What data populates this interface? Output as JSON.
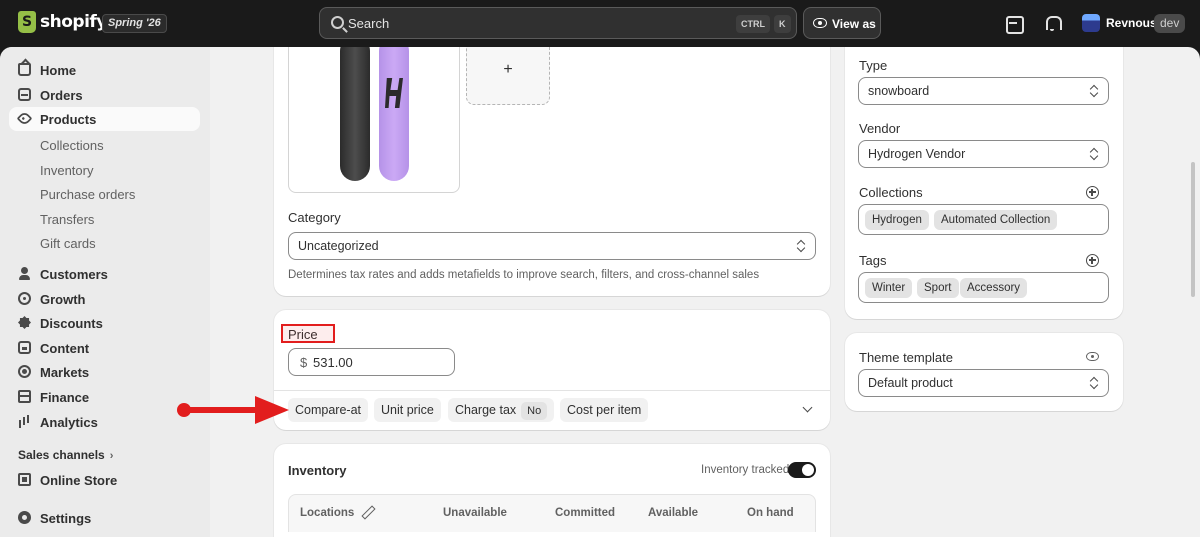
{
  "topbar": {
    "logo_text": "shopify",
    "edition": "Spring '26",
    "search_placeholder": "Search",
    "shortcut_ctrl": "CTRL",
    "shortcut_k": "K",
    "view_as": "View as",
    "store_name": "Revnous",
    "store_badge": "dev"
  },
  "sidebar": {
    "main": [
      {
        "label": "Home",
        "icon": "home-icon"
      },
      {
        "label": "Orders",
        "icon": "orders-icon"
      },
      {
        "label": "Products",
        "icon": "tag-icon",
        "active": true
      }
    ],
    "products_sub": [
      "Collections",
      "Inventory",
      "Purchase orders",
      "Transfers",
      "Gift cards"
    ],
    "more": [
      {
        "label": "Customers",
        "icon": "person-icon"
      },
      {
        "label": "Growth",
        "icon": "target-icon"
      },
      {
        "label": "Discounts",
        "icon": "discount-icon"
      },
      {
        "label": "Content",
        "icon": "content-icon"
      },
      {
        "label": "Markets",
        "icon": "globe-icon"
      },
      {
        "label": "Finance",
        "icon": "bank-icon"
      },
      {
        "label": "Analytics",
        "icon": "bar-chart-icon"
      }
    ],
    "sales_channels_title": "Sales channels",
    "online_store": "Online Store",
    "settings": "Settings"
  },
  "media": {
    "add_label": "+"
  },
  "category": {
    "label": "Category",
    "value": "Uncategorized",
    "help": "Determines tax rates and adds metafields to improve search, filters, and cross-channel sales"
  },
  "price": {
    "label": "Price",
    "currency": "$",
    "value": "531.00",
    "options": {
      "compare_at": "Compare-at",
      "unit_price": "Unit price",
      "charge_tax": "Charge tax",
      "charge_tax_value": "No",
      "cost_per_item": "Cost per item"
    }
  },
  "inventory": {
    "title": "Inventory",
    "tracked_label": "Inventory tracked",
    "tracked": true,
    "columns": [
      "Locations",
      "Unavailable",
      "Committed",
      "Available",
      "On hand"
    ]
  },
  "organization": {
    "type_label": "Type",
    "type_value": "snowboard",
    "vendor_label": "Vendor",
    "vendor_value": "Hydrogen Vendor",
    "collections_label": "Collections",
    "collections": [
      "Hydrogen",
      "Automated Collection"
    ],
    "tags_label": "Tags",
    "tags": [
      "Winter",
      "Sport",
      "Accessory"
    ]
  },
  "theme": {
    "label": "Theme template",
    "value": "Default product"
  },
  "annotation": {
    "color": "#e21d1d"
  }
}
